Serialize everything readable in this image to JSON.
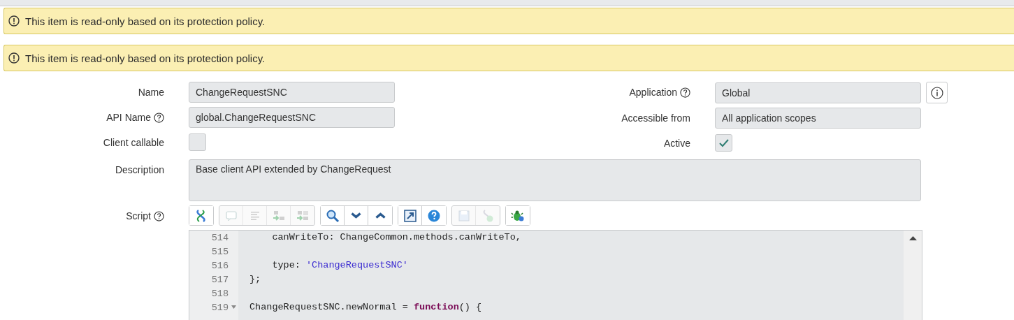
{
  "alerts": [
    {
      "text": "This item is read-only based on its protection policy."
    },
    {
      "text": "This item is read-only based on its protection policy."
    }
  ],
  "left_fields": [
    {
      "label": "Name",
      "help": false,
      "kind": "text",
      "value": "ChangeRequestSNC"
    },
    {
      "label": "API Name",
      "help": true,
      "kind": "text",
      "value": "global.ChangeRequestSNC"
    },
    {
      "label": "Client callable",
      "help": false,
      "kind": "checkbox",
      "checked": false
    }
  ],
  "right_fields": [
    {
      "label": "Application",
      "help": true,
      "kind": "text",
      "value": "Global",
      "info_button": true
    },
    {
      "label": "Accessible from",
      "help": false,
      "kind": "text",
      "value": "All application scopes",
      "info_button": false
    },
    {
      "label": "Active",
      "help": false,
      "kind": "checkbox",
      "checked": true,
      "info_button": false
    }
  ],
  "description": {
    "label": "Description",
    "value": "Base client API extended by ChangeRequest"
  },
  "script": {
    "label": "Script",
    "help": true,
    "toolbar": [
      [
        {
          "kind": "format",
          "disabled": false
        }
      ],
      [
        {
          "kind": "comment",
          "disabled": true
        },
        {
          "kind": "indent",
          "disabled": true
        },
        {
          "kind": "replace",
          "disabled": true
        },
        {
          "kind": "replace-all",
          "disabled": true
        }
      ],
      [
        {
          "kind": "search",
          "disabled": false
        },
        {
          "kind": "next",
          "disabled": false
        },
        {
          "kind": "previous",
          "disabled": false
        }
      ],
      [
        {
          "kind": "fullscreen",
          "disabled": false
        },
        {
          "kind": "help",
          "disabled": false
        }
      ],
      [
        {
          "kind": "save",
          "disabled": true
        },
        {
          "kind": "check",
          "disabled": true
        }
      ],
      [
        {
          "kind": "debug",
          "disabled": false
        }
      ]
    ],
    "lines": [
      {
        "number": "514",
        "fold": false,
        "tokens": [
          {
            "kind": "plain",
            "text": "    canWriteTo: ChangeCommon.methods.canWriteTo,"
          }
        ]
      },
      {
        "number": "515",
        "fold": false
      },
      {
        "number": "516",
        "fold": false,
        "tokens": [
          {
            "kind": "plain",
            "text": "    type: "
          },
          {
            "kind": "string",
            "text": "'ChangeRequestSNC'"
          }
        ]
      },
      {
        "number": "517",
        "fold": false,
        "tokens": [
          {
            "kind": "plain",
            "text": "};"
          }
        ]
      },
      {
        "number": "518",
        "fold": false
      },
      {
        "number": "519",
        "fold": true,
        "tokens": [
          {
            "kind": "plain",
            "text": "ChangeRequestSNC.newNormal = "
          },
          {
            "kind": "keyword",
            "text": "function"
          },
          {
            "kind": "plain",
            "text": "() {"
          }
        ]
      }
    ]
  }
}
